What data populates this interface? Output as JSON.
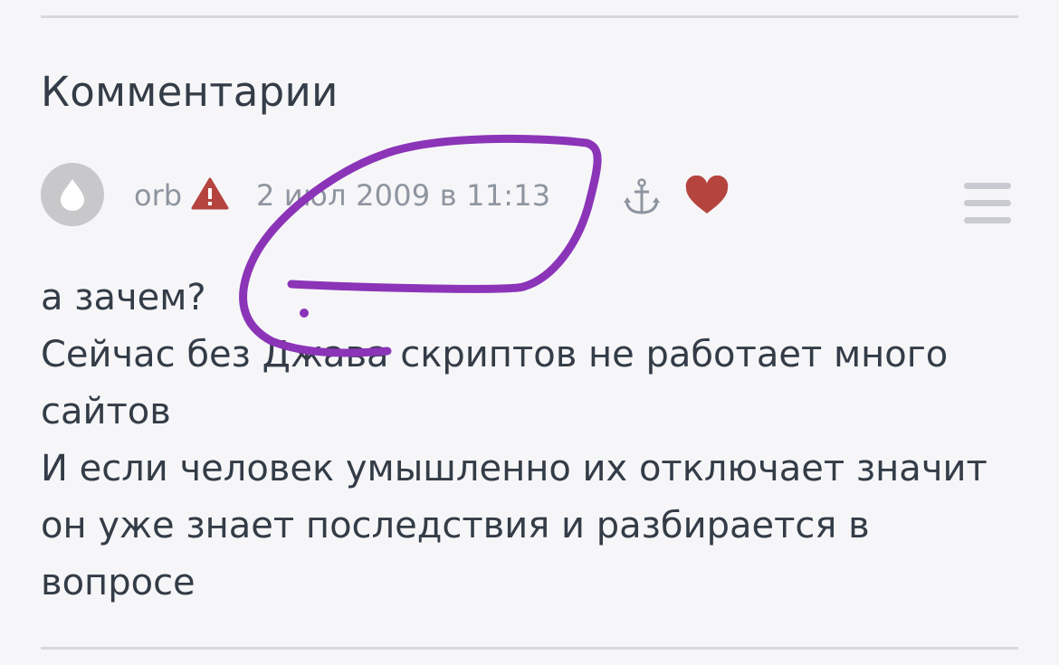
{
  "section": {
    "title": "Комментарии"
  },
  "comment": {
    "username": "orb",
    "timestamp": "2 июл 2009 в 11:13",
    "icons": {
      "avatar": "avatar-placeholder",
      "warning": "warning-icon",
      "anchor": "anchor-icon",
      "favorite": "heart-icon",
      "menu": "hamburger-menu-icon"
    },
    "lines": [
      "а зачем?",
      "Сейчас без Джава скриптов не работает много сайтов",
      "И если человек умышленно их отключает значит он уже знает последствия и разбирается в вопросе"
    ]
  },
  "colors": {
    "background": "#f6f6f8",
    "text": "#333c47",
    "meta": "#8e95a0",
    "warning": "#b5443f",
    "heart": "#b5443f",
    "annotation": "#8b34b8"
  }
}
